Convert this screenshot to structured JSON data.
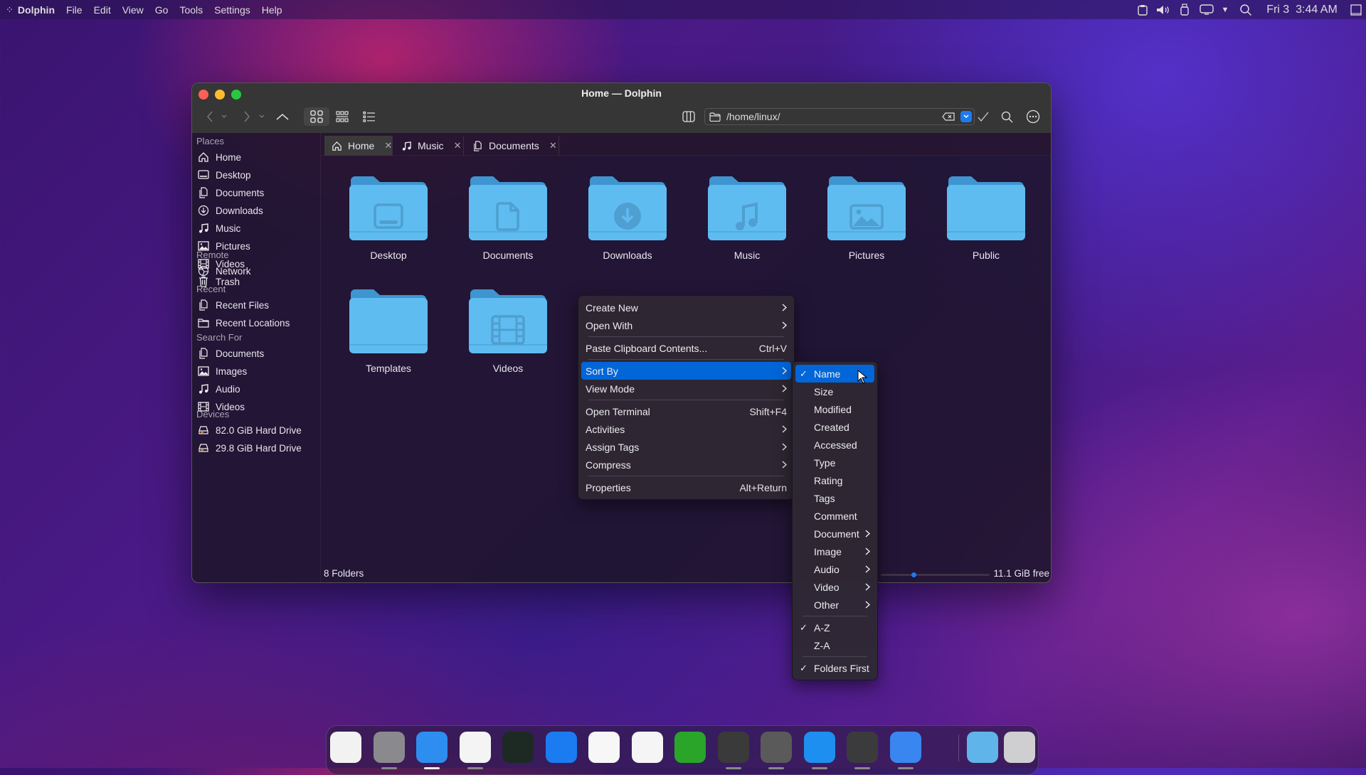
{
  "menubar": {
    "app": "Dolphin",
    "items": [
      "File",
      "Edit",
      "View",
      "Go",
      "Tools",
      "Settings",
      "Help"
    ],
    "clock": "Fri 3  3:44 AM"
  },
  "window": {
    "title": "Home — Dolphin",
    "location": "/home/linux/"
  },
  "tabs": [
    {
      "label": "Home",
      "icon": "home-icon",
      "active": true
    },
    {
      "label": "Music",
      "icon": "music-icon"
    },
    {
      "label": "Documents",
      "icon": "documents-icon"
    }
  ],
  "sidebar": {
    "sections": [
      {
        "title": "Places",
        "items": [
          {
            "label": "Home",
            "icon": "home"
          },
          {
            "label": "Desktop",
            "icon": "desktop"
          },
          {
            "label": "Documents",
            "icon": "documents"
          },
          {
            "label": "Downloads",
            "icon": "downloads"
          },
          {
            "label": "Music",
            "icon": "music"
          },
          {
            "label": "Pictures",
            "icon": "pictures"
          },
          {
            "label": "Videos",
            "icon": "videos"
          },
          {
            "label": "Trash",
            "icon": "trash"
          }
        ]
      },
      {
        "title": "Remote",
        "items": [
          {
            "label": "Network",
            "icon": "network"
          }
        ]
      },
      {
        "title": "Recent",
        "items": [
          {
            "label": "Recent Files",
            "icon": "documents"
          },
          {
            "label": "Recent Locations",
            "icon": "folder"
          }
        ]
      },
      {
        "title": "Search For",
        "items": [
          {
            "label": "Documents",
            "icon": "documents"
          },
          {
            "label": "Images",
            "icon": "pictures"
          },
          {
            "label": "Audio",
            "icon": "music"
          },
          {
            "label": "Videos",
            "icon": "videos"
          }
        ]
      },
      {
        "title": "Devices",
        "items": [
          {
            "label": "82.0 GiB Hard Drive",
            "icon": "drive"
          },
          {
            "label": "29.8 GiB Hard Drive",
            "icon": "drive"
          }
        ]
      }
    ]
  },
  "folders": [
    {
      "label": "Desktop",
      "glyph": "desktop"
    },
    {
      "label": "Documents",
      "glyph": "documents"
    },
    {
      "label": "Downloads",
      "glyph": "downloads"
    },
    {
      "label": "Music",
      "glyph": "music"
    },
    {
      "label": "Pictures",
      "glyph": "pictures"
    },
    {
      "label": "Public",
      "glyph": "none"
    },
    {
      "label": "Templates",
      "glyph": "none"
    },
    {
      "label": "Videos",
      "glyph": "videos"
    }
  ],
  "status": {
    "summary": "8 Folders",
    "free": "11.1 GiB free",
    "zoom_level": 0.3
  },
  "context_menu": [
    {
      "label": "Create New",
      "submenu": true
    },
    {
      "label": "Open With",
      "submenu": true
    },
    {
      "sep": true
    },
    {
      "label": "Paste Clipboard Contents...",
      "shortcut": "Ctrl+V"
    },
    {
      "sep": true
    },
    {
      "label": "Sort By",
      "submenu": true,
      "highlight": true
    },
    {
      "label": "View Mode",
      "submenu": true
    },
    {
      "sep": true
    },
    {
      "label": "Open Terminal",
      "shortcut": "Shift+F4"
    },
    {
      "label": "Activities",
      "submenu": true
    },
    {
      "label": "Assign Tags",
      "submenu": true
    },
    {
      "label": "Compress",
      "submenu": true
    },
    {
      "sep": true
    },
    {
      "label": "Properties",
      "shortcut": "Alt+Return"
    }
  ],
  "sort_menu": [
    {
      "label": "Name",
      "checked": true,
      "highlight": true
    },
    {
      "label": "Size"
    },
    {
      "label": "Modified"
    },
    {
      "label": "Created"
    },
    {
      "label": "Accessed"
    },
    {
      "label": "Type"
    },
    {
      "label": "Rating"
    },
    {
      "label": "Tags"
    },
    {
      "label": "Comment"
    },
    {
      "label": "Document",
      "submenu": true
    },
    {
      "label": "Image",
      "submenu": true
    },
    {
      "label": "Audio",
      "submenu": true
    },
    {
      "label": "Video",
      "submenu": true
    },
    {
      "label": "Other",
      "submenu": true
    },
    {
      "sep": true
    },
    {
      "label": "A-Z",
      "checked": true
    },
    {
      "label": "Z-A"
    },
    {
      "sep": true
    },
    {
      "label": "Folders First",
      "checked": true
    }
  ],
  "dock": [
    {
      "name": "launchpad",
      "color": "#f2f2f2",
      "running": false
    },
    {
      "name": "system-settings",
      "color": "#8a8a8e",
      "running": true
    },
    {
      "name": "finder",
      "color": "#2d8ef0",
      "running": true,
      "active": true
    },
    {
      "name": "firefox",
      "color": "#f4f4f4",
      "running": true
    },
    {
      "name": "system-monitor",
      "color": "#1d2a24",
      "running": false
    },
    {
      "name": "app-store",
      "color": "#1a7cf0",
      "running": false
    },
    {
      "name": "photos",
      "color": "#f7f7f7",
      "running": false
    },
    {
      "name": "preview",
      "color": "#f5f5f5",
      "running": false
    },
    {
      "name": "spreadsheet",
      "color": "#2aa52a",
      "running": false
    },
    {
      "name": "inkscape",
      "color": "#3a3a3a",
      "running": true
    },
    {
      "name": "kvantum",
      "color": "#5a5a5a",
      "running": true
    },
    {
      "name": "kite",
      "color": "#1d8ff0",
      "running": true
    },
    {
      "name": "screenshot",
      "color": "#3b3b3d",
      "running": true
    },
    {
      "name": "widgets",
      "color": "#3a86f0",
      "running": true
    },
    {
      "name": "downloads-folder",
      "color": "#5fb4ea",
      "running": false
    },
    {
      "name": "trash",
      "color": "#cfcfd2",
      "running": false
    }
  ],
  "colors": {
    "accent": "#0266d8",
    "folder": "#5fbcf0",
    "close": "#fe5f57",
    "minimize": "#febc2e",
    "maximize": "#28c840"
  }
}
